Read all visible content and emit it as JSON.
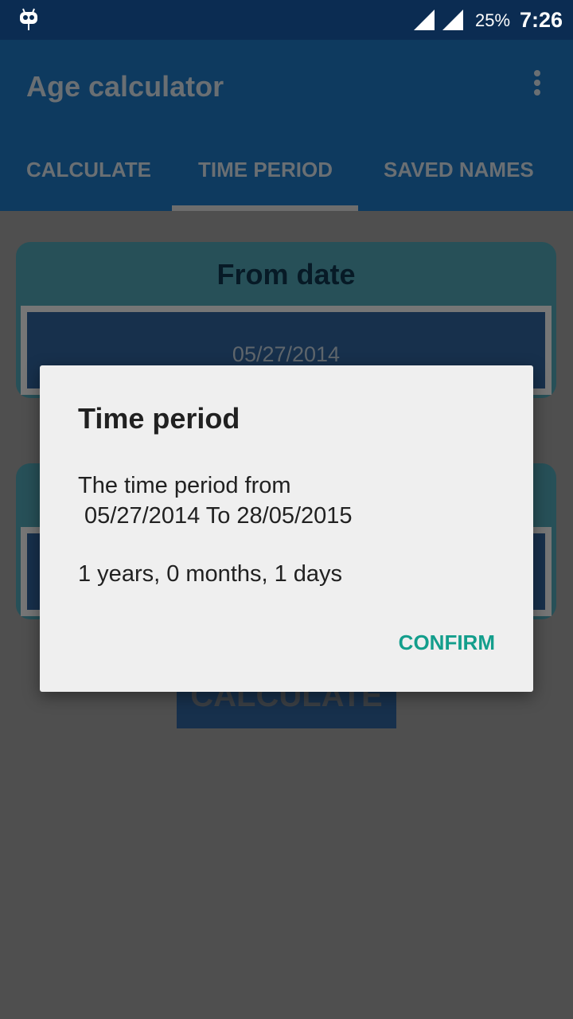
{
  "status_bar": {
    "battery": "25%",
    "time": "7:26",
    "icons": [
      "cyanogen-robot-icon",
      "signal-roaming-icon",
      "signal-icon"
    ]
  },
  "app_bar": {
    "title": "Age calculator",
    "menu_icon": "more-vert-icon"
  },
  "tabs": [
    {
      "label": "CALCULATE"
    },
    {
      "label": "TIME PERIOD",
      "selected": true
    },
    {
      "label": "SAVED NAMES"
    }
  ],
  "from_card": {
    "title": "From date",
    "value": "05/27/2014"
  },
  "calculate_button": "CALCULATE",
  "dialog": {
    "title": "Time period",
    "message": "The time period from\n 05/27/2014 To 28/05/2015",
    "result": "1 years, 0 months, 1 days",
    "confirm": "CONFIRM"
  },
  "colors": {
    "accent": "#139e8c",
    "app_bar": "#0e3a5f",
    "status_bar": "#0b2c52"
  }
}
